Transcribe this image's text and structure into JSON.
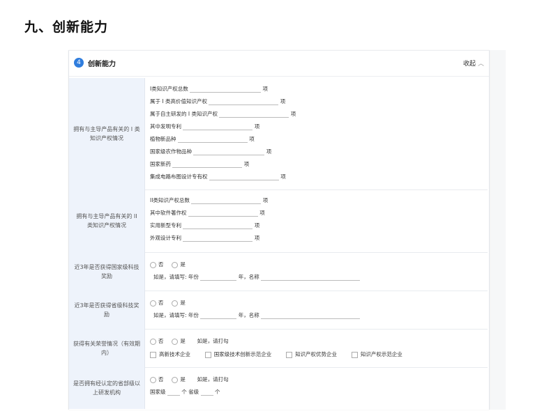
{
  "page_heading": "九、创新能力",
  "section": {
    "number": "4",
    "title": "创新能力",
    "collapse_label": "收起"
  },
  "rows": {
    "ip1": {
      "label": "拥有与主导产品有关的 I 类知识产权情况",
      "fields": [
        {
          "label": "I类知识产权总数",
          "unit": "项"
        },
        {
          "label": "属于 I 类高价值知识产权",
          "unit": "项"
        },
        {
          "label": "属于自主研发的 I 类知识产权",
          "unit": "项"
        },
        {
          "label": "其中发明专利",
          "unit": "项"
        },
        {
          "label": "植物新品种",
          "unit": "项"
        },
        {
          "label": "国家级农作物品种",
          "unit": "项"
        },
        {
          "label": "国家新药",
          "unit": "项"
        },
        {
          "label": "集成电路布图设计专有权",
          "unit": "项"
        }
      ]
    },
    "ip2": {
      "label": "拥有与主导产品有关的 II 类知识产权情况",
      "fields": [
        {
          "label": "II类知识产权总数",
          "unit": "项"
        },
        {
          "label": "其中软件著作权",
          "unit": "项"
        },
        {
          "label": "实用新型专利",
          "unit": "项"
        },
        {
          "label": "外观设计专利",
          "unit": "项"
        }
      ]
    },
    "national_award": {
      "label": "近3年是否获得国家级科技奖励",
      "no": "否",
      "yes": "是",
      "prompt": "如是，请填写: 年份",
      "year_unit": "年，名称"
    },
    "provincial_award": {
      "label": "近3年是否获得省级科技奖励",
      "no": "否",
      "yes": "是",
      "prompt": "如是，请填写: 年份",
      "year_unit": "年，名称"
    },
    "honors": {
      "label": "获得有关荣誉情况（有效期内）",
      "no": "否",
      "yes": "是",
      "hint": "如是，请打勾",
      "checks": [
        "高新技术企业",
        "国家级技术创新示范企业",
        "知识产权优势企业",
        "知识产权示范企业"
      ]
    },
    "rd_center": {
      "label": "是否拥有经认定的省部级以上研发机构",
      "no": "否",
      "yes": "是",
      "hint": "如是，请打勾",
      "national": "国家级",
      "count_unit": "个",
      "provincial": "省级",
      "count_unit2": "个"
    }
  }
}
